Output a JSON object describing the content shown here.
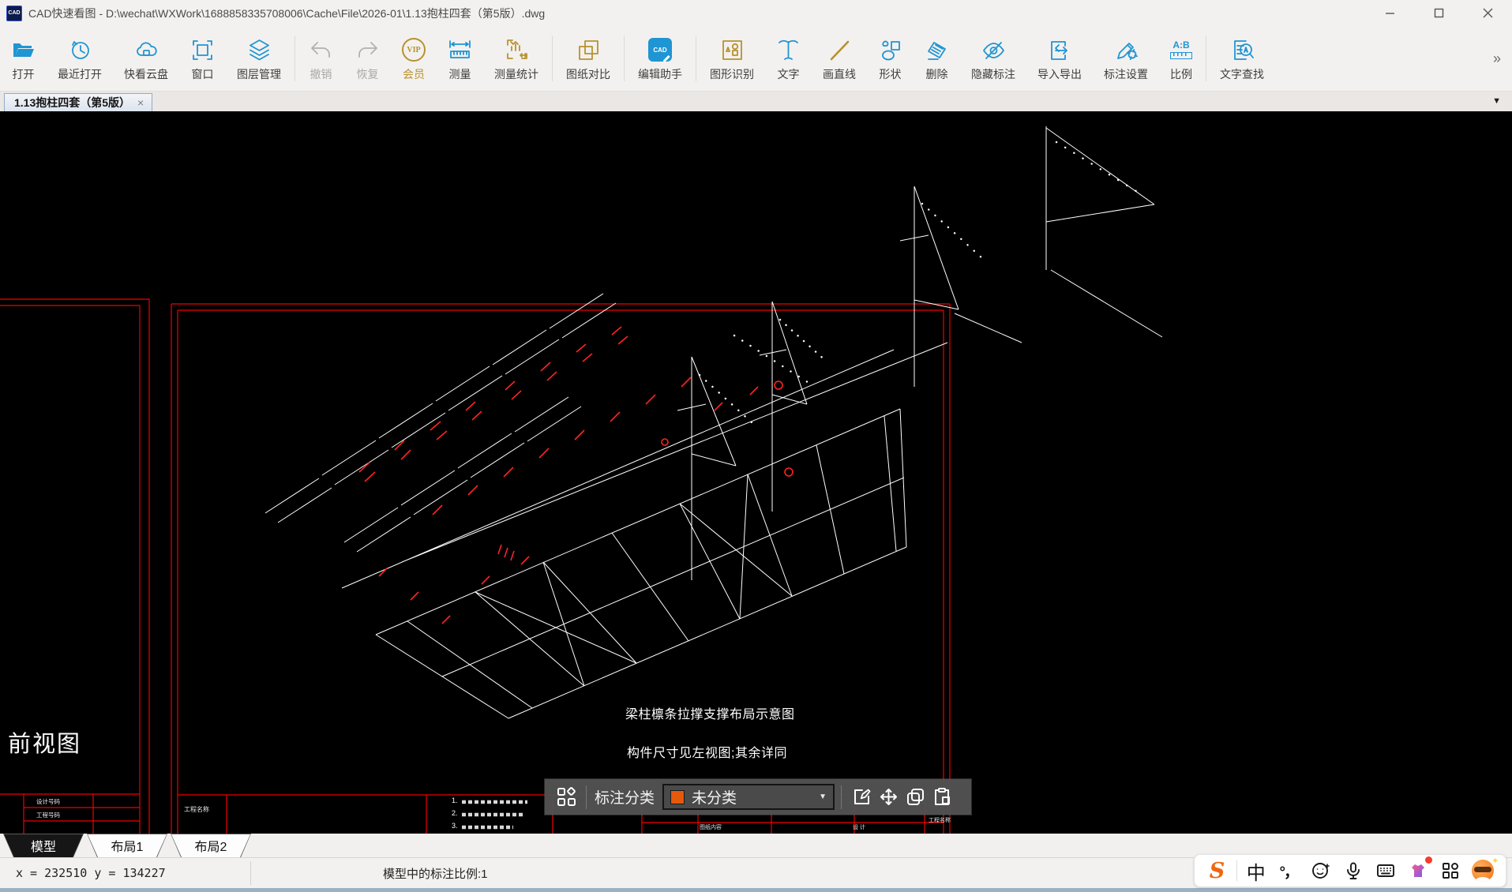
{
  "window": {
    "app_logo": "CAD",
    "title": "CAD快速看图 - D:\\wechat\\WXWork\\1688858335708006\\Cache\\File\\2026-01\\1.13抱柱四套（第5版）.dwg"
  },
  "toolbar": {
    "overflow": "»",
    "items": [
      {
        "label": "打开",
        "icon": "open-file-icon",
        "color": "#1f95d4"
      },
      {
        "label": "最近打开",
        "icon": "recent-files-icon",
        "color": "#1f95d4"
      },
      {
        "label": "快看云盘",
        "icon": "cloud-drive-icon",
        "color": "#1f95d4"
      },
      {
        "label": "窗口",
        "icon": "window-select-icon",
        "color": "#1f95d4"
      },
      {
        "label": "图层管理",
        "icon": "layers-icon",
        "color": "#1f95d4"
      },
      {
        "label": "撤销",
        "icon": "undo-icon",
        "color": "#b3b0ad",
        "disabled": true
      },
      {
        "label": "恢复",
        "icon": "redo-icon",
        "color": "#b3b0ad",
        "disabled": true
      },
      {
        "label": "会员",
        "icon": "vip-icon",
        "color": "#b7922e"
      },
      {
        "label": "测量",
        "icon": "measure-icon",
        "color": "#1f95d4"
      },
      {
        "label": "测量统计",
        "icon": "measure-stats-icon",
        "color": "#b7922e"
      },
      {
        "label": "图纸对比",
        "icon": "drawing-compare-icon",
        "color": "#b7922e"
      },
      {
        "label": "编辑助手",
        "icon": "edit-assistant-icon",
        "color": "#1f95d4"
      },
      {
        "label": "图形识别",
        "icon": "shape-recognition-icon",
        "color": "#b7922e"
      },
      {
        "label": "文字",
        "icon": "text-icon",
        "color": "#1f95d4"
      },
      {
        "label": "画直线",
        "icon": "draw-line-icon",
        "color": "#b7922e"
      },
      {
        "label": "形状",
        "icon": "shapes-icon",
        "color": "#1f95d4"
      },
      {
        "label": "删除",
        "icon": "erase-icon",
        "color": "#1f95d4"
      },
      {
        "label": "隐藏标注",
        "icon": "hide-annotations-icon",
        "color": "#1f95d4"
      },
      {
        "label": "导入导出",
        "icon": "import-export-icon",
        "color": "#1f95d4"
      },
      {
        "label": "标注设置",
        "icon": "annotation-settings-icon",
        "color": "#1f95d4"
      },
      {
        "label": "比例",
        "icon": "scale-icon",
        "color": "#1f95d4"
      },
      {
        "label": "文字查找",
        "icon": "text-search-icon",
        "color": "#1f95d4"
      }
    ]
  },
  "doc_tabs": {
    "active_label": "1.13抱柱四套（第5版）",
    "close_glyph": "×",
    "list_arrow": "▼"
  },
  "drawing": {
    "front_view_label": "前视图",
    "title": "梁柱檩条拉撑支撑布局示意图",
    "subtitle": "构件尺寸见左视图;其余详同",
    "titleblock": {
      "design_no": "设计号码",
      "project_no": "工程号码",
      "project_name": "工程名称",
      "sheet_content": "图纸内容",
      "design": "设 计",
      "project_name_right": "工程名称",
      "note_1": "1.",
      "note_2": "2.",
      "note_3": "3."
    },
    "colors": {
      "lines": "#ffffff",
      "frame": "#ff0000",
      "annotations": "#ff2222"
    }
  },
  "annotation_bar": {
    "category_label": "标注分类",
    "selected_category": "未分类",
    "swatch_color": "#e4590b",
    "dropdown_arrow": "▼",
    "button_icons": [
      "grid-icon",
      "edit-annotation-icon",
      "move-icon",
      "copy-icon",
      "paste-icon"
    ]
  },
  "sheet_tabs": [
    {
      "label": "模型",
      "active": true
    },
    {
      "label": "布局1",
      "active": false
    },
    {
      "label": "布局2",
      "active": false
    }
  ],
  "status_bar": {
    "coordinates": "x = 232510  y = 134227",
    "annotation_scale": "模型中的标注比例:1"
  },
  "ime_bar": {
    "logo": "S",
    "mode_label": "中",
    "punctuation": "°，",
    "icons": [
      "sogou-logo-icon",
      "chinese-mode-icon",
      "punctuation-icon",
      "emoji-icon",
      "microphone-icon",
      "keyboard-icon",
      "skin-icon",
      "toolbox-grid-icon",
      "assistant-badge-icon"
    ]
  }
}
